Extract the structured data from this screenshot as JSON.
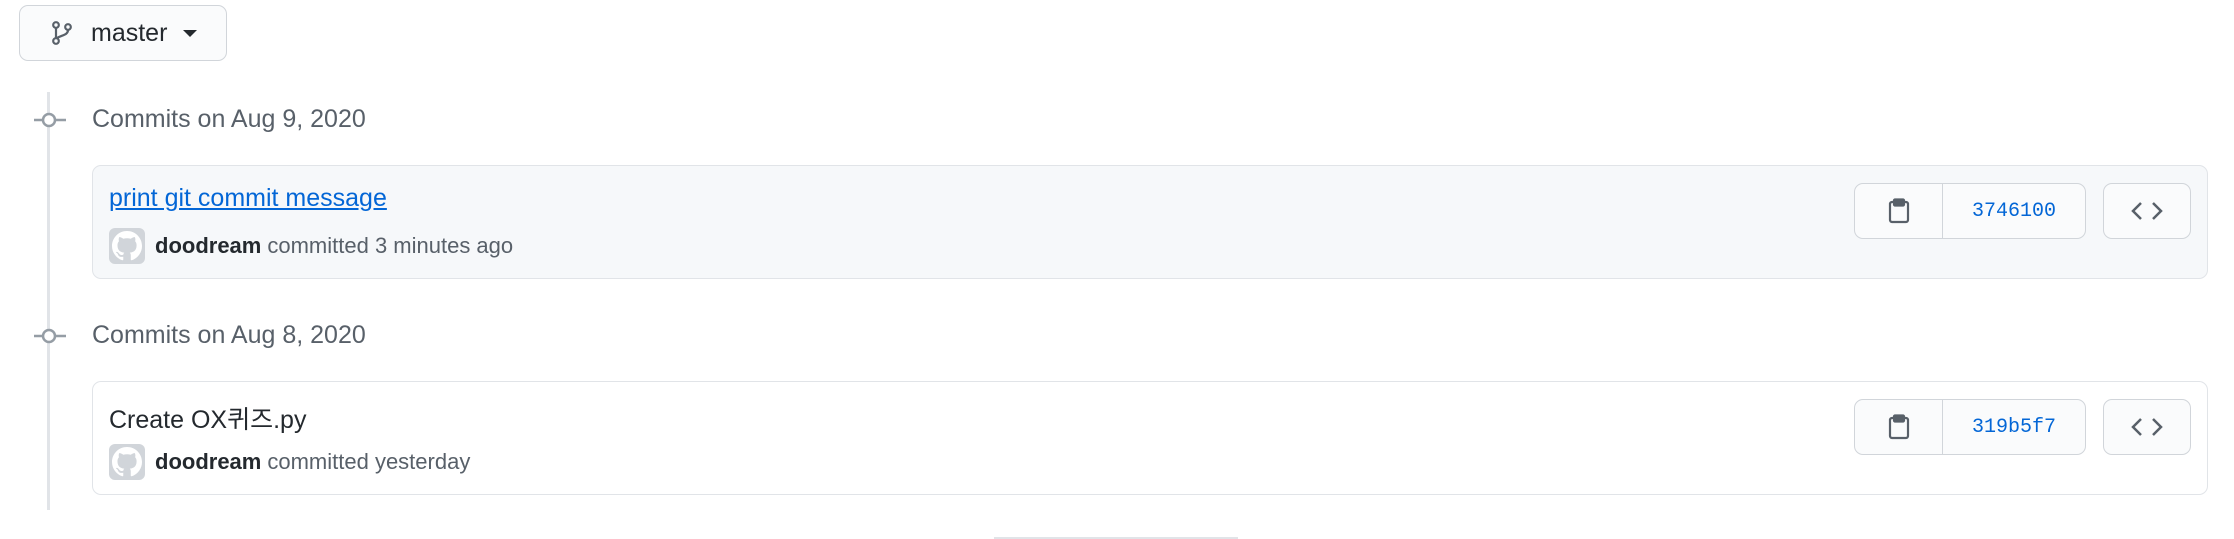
{
  "branch": {
    "name": "master"
  },
  "groups": [
    {
      "title": "Commits on Aug 9, 2020",
      "commit": {
        "message": "print git commit message",
        "author": "doodream",
        "time_text": "committed 3 minutes ago",
        "sha": "3746100"
      }
    },
    {
      "title": "Commits on Aug 8, 2020",
      "commit": {
        "message": "Create OX퀴즈.py",
        "author": "doodream",
        "time_text": "committed yesterday",
        "sha": "319b5f7"
      }
    }
  ],
  "icons": {
    "branch": "git-branch-icon",
    "caret": "caret-down-icon",
    "commit_node": "git-commit-icon",
    "avatar": "github-octocat-icon",
    "copy": "clipboard-icon",
    "browse": "code-icon"
  },
  "colors": {
    "link": "#0366d6",
    "sha": "#0366d6",
    "muted": "#586069",
    "border": "#d1d5da",
    "highlight_bg": "#f6f8fa"
  }
}
